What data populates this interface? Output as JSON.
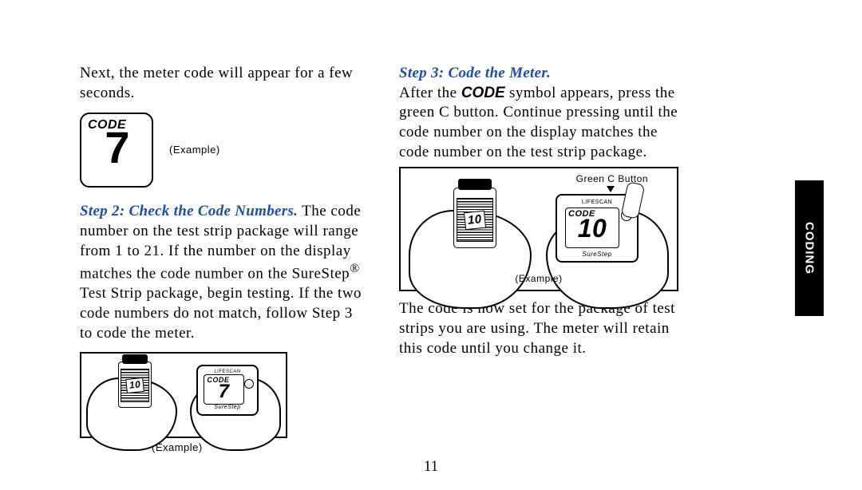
{
  "side_tab": "CODING",
  "page_number": "11",
  "col1": {
    "intro": "Next, the meter code will appear for a few seconds.",
    "fig1": {
      "code_label": "CODE",
      "value": "7",
      "caption": "(Example)"
    },
    "step2_heading": "Step 2: Check the Code Numbers.",
    "step2_body_before_reg": "The code number on the test strip package will range from 1 to 21. If the number on the display matches the code number on the SureStep",
    "reg_mark": "®",
    "step2_body_after_reg": " Test Strip package, begin testing. If the two code numbers do not match, follow Step 3 to code the meter.",
    "fig2": {
      "bottle_code": "10",
      "meter_brand": "LIFESCAN",
      "meter_code_label": "CODE",
      "meter_code_value": "7",
      "meter_footer": "SureStep",
      "caption": "(Example)"
    }
  },
  "col2": {
    "step3_heading": "Step 3: Code the Meter.",
    "step3_body_pre": "After the ",
    "step3_code_word": "CODE",
    "step3_body_post": " symbol appears, press the green C button. Continue pressing until the code number on the display matches the code number on the test strip package.",
    "fig3": {
      "green_label": "Green C Button",
      "bottle_code": "10",
      "meter_brand": "LIFESCAN",
      "meter_code_label": "CODE",
      "meter_code_value": "10",
      "meter_footer": "SureStep",
      "caption": "(Example)"
    },
    "closing": "The code is now set for the package of test strips you are using. The meter will retain this code until you change it."
  }
}
